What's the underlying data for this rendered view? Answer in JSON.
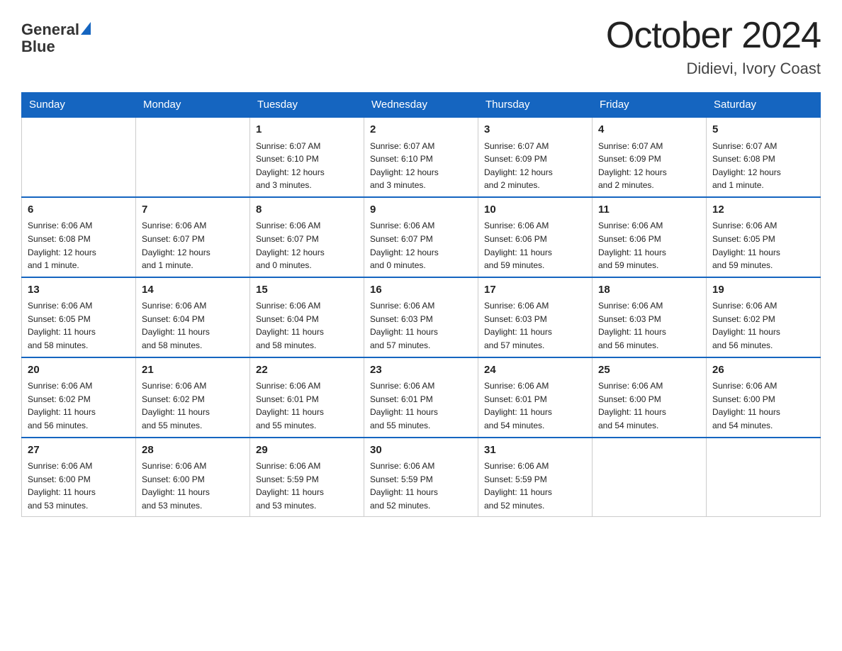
{
  "header": {
    "logo_text_general": "General",
    "logo_text_blue": "Blue",
    "title": "October 2024",
    "subtitle": "Didievi, Ivory Coast"
  },
  "weekdays": [
    "Sunday",
    "Monday",
    "Tuesday",
    "Wednesday",
    "Thursday",
    "Friday",
    "Saturday"
  ],
  "weeks": [
    [
      {
        "day": "",
        "info": ""
      },
      {
        "day": "",
        "info": ""
      },
      {
        "day": "1",
        "info": "Sunrise: 6:07 AM\nSunset: 6:10 PM\nDaylight: 12 hours\nand 3 minutes."
      },
      {
        "day": "2",
        "info": "Sunrise: 6:07 AM\nSunset: 6:10 PM\nDaylight: 12 hours\nand 3 minutes."
      },
      {
        "day": "3",
        "info": "Sunrise: 6:07 AM\nSunset: 6:09 PM\nDaylight: 12 hours\nand 2 minutes."
      },
      {
        "day": "4",
        "info": "Sunrise: 6:07 AM\nSunset: 6:09 PM\nDaylight: 12 hours\nand 2 minutes."
      },
      {
        "day": "5",
        "info": "Sunrise: 6:07 AM\nSunset: 6:08 PM\nDaylight: 12 hours\nand 1 minute."
      }
    ],
    [
      {
        "day": "6",
        "info": "Sunrise: 6:06 AM\nSunset: 6:08 PM\nDaylight: 12 hours\nand 1 minute."
      },
      {
        "day": "7",
        "info": "Sunrise: 6:06 AM\nSunset: 6:07 PM\nDaylight: 12 hours\nand 1 minute."
      },
      {
        "day": "8",
        "info": "Sunrise: 6:06 AM\nSunset: 6:07 PM\nDaylight: 12 hours\nand 0 minutes."
      },
      {
        "day": "9",
        "info": "Sunrise: 6:06 AM\nSunset: 6:07 PM\nDaylight: 12 hours\nand 0 minutes."
      },
      {
        "day": "10",
        "info": "Sunrise: 6:06 AM\nSunset: 6:06 PM\nDaylight: 11 hours\nand 59 minutes."
      },
      {
        "day": "11",
        "info": "Sunrise: 6:06 AM\nSunset: 6:06 PM\nDaylight: 11 hours\nand 59 minutes."
      },
      {
        "day": "12",
        "info": "Sunrise: 6:06 AM\nSunset: 6:05 PM\nDaylight: 11 hours\nand 59 minutes."
      }
    ],
    [
      {
        "day": "13",
        "info": "Sunrise: 6:06 AM\nSunset: 6:05 PM\nDaylight: 11 hours\nand 58 minutes."
      },
      {
        "day": "14",
        "info": "Sunrise: 6:06 AM\nSunset: 6:04 PM\nDaylight: 11 hours\nand 58 minutes."
      },
      {
        "day": "15",
        "info": "Sunrise: 6:06 AM\nSunset: 6:04 PM\nDaylight: 11 hours\nand 58 minutes."
      },
      {
        "day": "16",
        "info": "Sunrise: 6:06 AM\nSunset: 6:03 PM\nDaylight: 11 hours\nand 57 minutes."
      },
      {
        "day": "17",
        "info": "Sunrise: 6:06 AM\nSunset: 6:03 PM\nDaylight: 11 hours\nand 57 minutes."
      },
      {
        "day": "18",
        "info": "Sunrise: 6:06 AM\nSunset: 6:03 PM\nDaylight: 11 hours\nand 56 minutes."
      },
      {
        "day": "19",
        "info": "Sunrise: 6:06 AM\nSunset: 6:02 PM\nDaylight: 11 hours\nand 56 minutes."
      }
    ],
    [
      {
        "day": "20",
        "info": "Sunrise: 6:06 AM\nSunset: 6:02 PM\nDaylight: 11 hours\nand 56 minutes."
      },
      {
        "day": "21",
        "info": "Sunrise: 6:06 AM\nSunset: 6:02 PM\nDaylight: 11 hours\nand 55 minutes."
      },
      {
        "day": "22",
        "info": "Sunrise: 6:06 AM\nSunset: 6:01 PM\nDaylight: 11 hours\nand 55 minutes."
      },
      {
        "day": "23",
        "info": "Sunrise: 6:06 AM\nSunset: 6:01 PM\nDaylight: 11 hours\nand 55 minutes."
      },
      {
        "day": "24",
        "info": "Sunrise: 6:06 AM\nSunset: 6:01 PM\nDaylight: 11 hours\nand 54 minutes."
      },
      {
        "day": "25",
        "info": "Sunrise: 6:06 AM\nSunset: 6:00 PM\nDaylight: 11 hours\nand 54 minutes."
      },
      {
        "day": "26",
        "info": "Sunrise: 6:06 AM\nSunset: 6:00 PM\nDaylight: 11 hours\nand 54 minutes."
      }
    ],
    [
      {
        "day": "27",
        "info": "Sunrise: 6:06 AM\nSunset: 6:00 PM\nDaylight: 11 hours\nand 53 minutes."
      },
      {
        "day": "28",
        "info": "Sunrise: 6:06 AM\nSunset: 6:00 PM\nDaylight: 11 hours\nand 53 minutes."
      },
      {
        "day": "29",
        "info": "Sunrise: 6:06 AM\nSunset: 5:59 PM\nDaylight: 11 hours\nand 53 minutes."
      },
      {
        "day": "30",
        "info": "Sunrise: 6:06 AM\nSunset: 5:59 PM\nDaylight: 11 hours\nand 52 minutes."
      },
      {
        "day": "31",
        "info": "Sunrise: 6:06 AM\nSunset: 5:59 PM\nDaylight: 11 hours\nand 52 minutes."
      },
      {
        "day": "",
        "info": ""
      },
      {
        "day": "",
        "info": ""
      }
    ]
  ]
}
